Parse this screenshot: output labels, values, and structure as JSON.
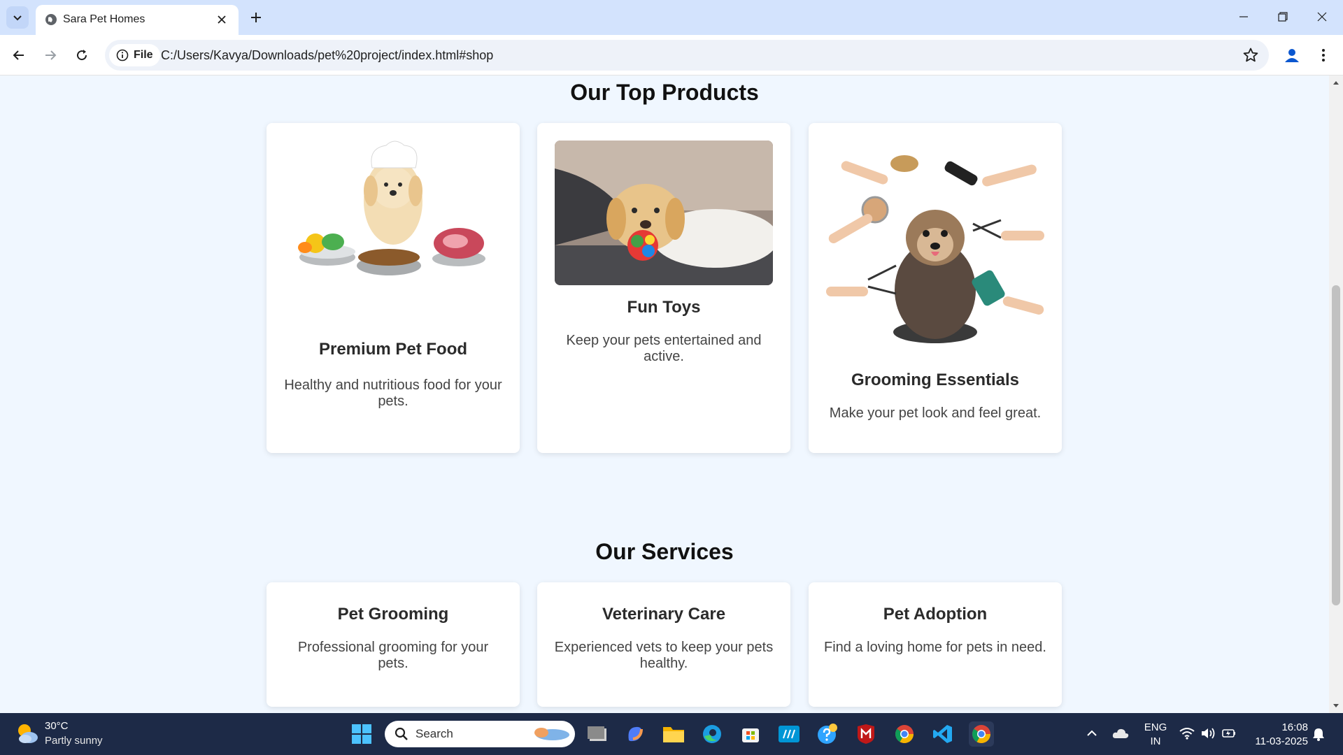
{
  "browser": {
    "tab_title": "Sara Pet Homes",
    "url_chip": "File",
    "url": "C:/Users/Kavya/Downloads/pet%20project/index.html#shop"
  },
  "products": {
    "heading": "Our Top Products",
    "items": [
      {
        "title": "Premium Pet Food",
        "desc": "Healthy and nutritious food for your pets."
      },
      {
        "title": "Fun Toys",
        "desc": "Keep your pets entertained and active."
      },
      {
        "title": "Grooming Essentials",
        "desc": "Make your pet look and feel great."
      }
    ]
  },
  "services": {
    "heading": "Our Services",
    "items": [
      {
        "title": "Pet Grooming",
        "desc": "Professional grooming for your pets."
      },
      {
        "title": "Veterinary Care",
        "desc": "Experienced vets to keep your pets healthy."
      },
      {
        "title": "Pet Adoption",
        "desc": "Find a loving home for pets in need."
      }
    ]
  },
  "taskbar": {
    "weather_temp": "30°C",
    "weather_desc": "Partly sunny",
    "search_label": "Search",
    "lang_top": "ENG",
    "lang_bottom": "IN",
    "time": "16:08",
    "date": "11-03-2025"
  },
  "colors": {
    "page_bg": "#f0f7ff",
    "tabstrip_bg": "#d3e3fd",
    "taskbar_bg": "#1d2a47"
  }
}
